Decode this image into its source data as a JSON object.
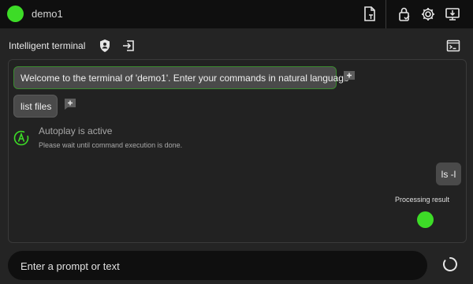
{
  "header": {
    "title": "demo1",
    "icons": [
      "file-icon",
      "lock-check-icon",
      "gear-icon",
      "monitor-download-icon"
    ]
  },
  "terminal": {
    "title": "Intelligent terminal",
    "icons": [
      "shield-person-icon",
      "sign-in-icon",
      "console-icon"
    ]
  },
  "messages": [
    {
      "role": "system",
      "text": "Welcome to the terminal of 'demo1'. Enter your commands in natural language"
    },
    {
      "role": "assistant",
      "text": "list files"
    },
    {
      "role": "user",
      "text": "ls -l"
    }
  ],
  "autoplay": {
    "title": "Autoplay is active",
    "description": "Please wait until command execution is done."
  },
  "processing": {
    "label": "Processing result"
  },
  "prompt": {
    "placeholder": "Enter a prompt or text",
    "value": ""
  },
  "colors": {
    "accent": "#3ddc27",
    "background": "#242424",
    "topbar": "#0f0f0f",
    "bubble": "#4a4a4a",
    "bubble_border": "#3a8a2f"
  }
}
